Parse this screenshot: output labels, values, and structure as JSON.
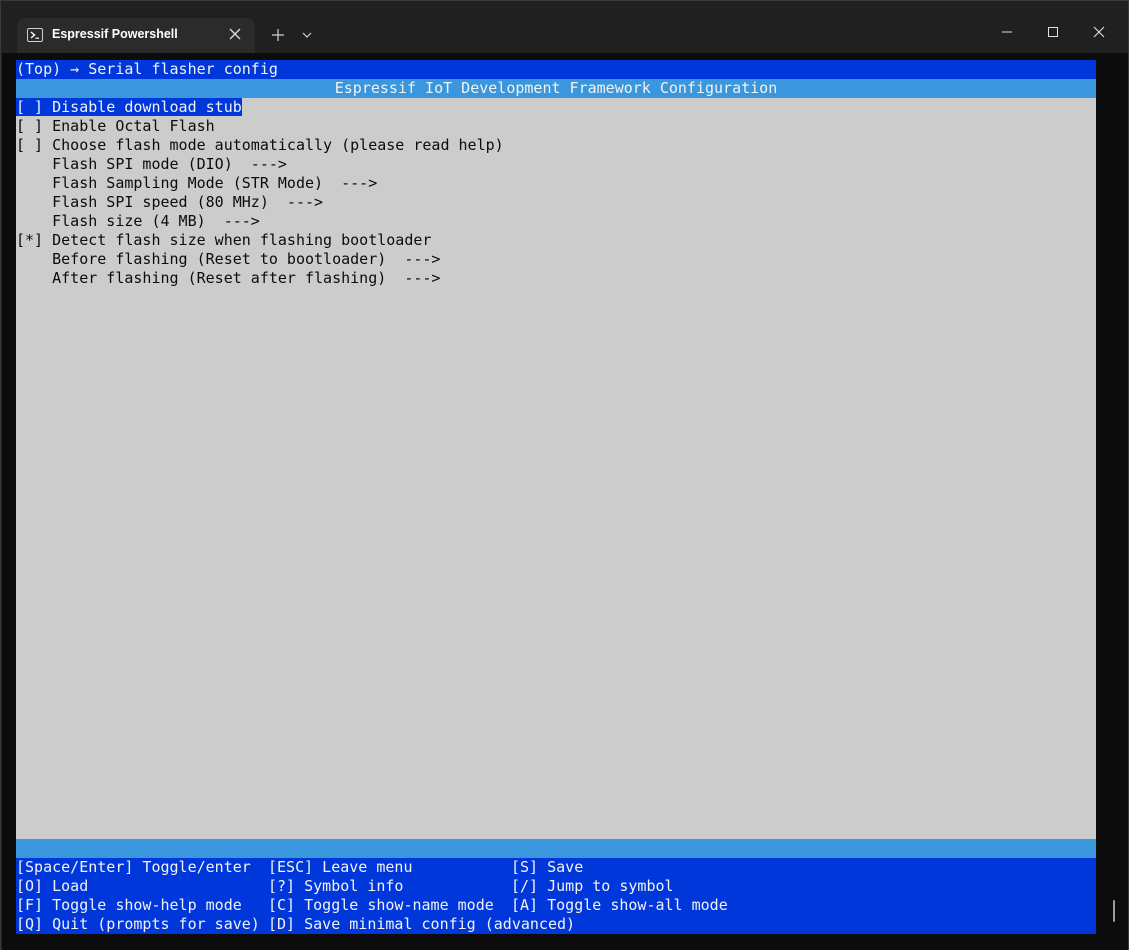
{
  "window": {
    "tab_title": "Espressif Powershell",
    "icons": {
      "tab": "powershell-icon",
      "close_tab": "close-icon",
      "new_tab": "plus-icon",
      "dropdown": "chevron-down-icon",
      "minimize": "minimize-icon",
      "maximize": "maximize-icon",
      "close": "close-icon"
    }
  },
  "colors": {
    "terminal_blue": "#0037da",
    "header_cyan": "#3a96dd",
    "menu_gray": "#cccccc",
    "text_light": "#f2f2f2",
    "text_dark": "#0c0c0c"
  },
  "breadcrumb": "(Top) → Serial flasher config",
  "config_title": "Espressif IoT Development Framework Configuration",
  "menu": {
    "selected_index": 0,
    "items": [
      {
        "prefix": "[ ] ",
        "label": "Disable download stub"
      },
      {
        "prefix": "[ ] ",
        "label": "Enable Octal Flash"
      },
      {
        "prefix": "[ ] ",
        "label": "Choose flash mode automatically (please read help)"
      },
      {
        "prefix": "    ",
        "label": "Flash SPI mode (DIO)  --->"
      },
      {
        "prefix": "    ",
        "label": "Flash Sampling Mode (STR Mode)  --->"
      },
      {
        "prefix": "    ",
        "label": "Flash SPI speed (80 MHz)  --->"
      },
      {
        "prefix": "    ",
        "label": "Flash size (4 MB)  --->"
      },
      {
        "prefix": "[*] ",
        "label": "Detect flash size when flashing bootloader"
      },
      {
        "prefix": "    ",
        "label": "Before flashing (Reset to bootloader)  --->"
      },
      {
        "prefix": "    ",
        "label": "After flashing (Reset after flashing)  --->"
      }
    ]
  },
  "keys": {
    "rows": [
      [
        "[Space/Enter] Toggle/enter",
        "[ESC] Leave menu",
        "[S] Save"
      ],
      [
        "[O] Load",
        "[?] Symbol info",
        "[/] Jump to symbol"
      ],
      [
        "[F] Toggle show-help mode",
        "[C] Toggle show-name mode",
        "[A] Toggle show-all mode"
      ],
      [
        "[Q] Quit (prompts for save)",
        "[D] Save minimal config (advanced)",
        ""
      ]
    ]
  }
}
